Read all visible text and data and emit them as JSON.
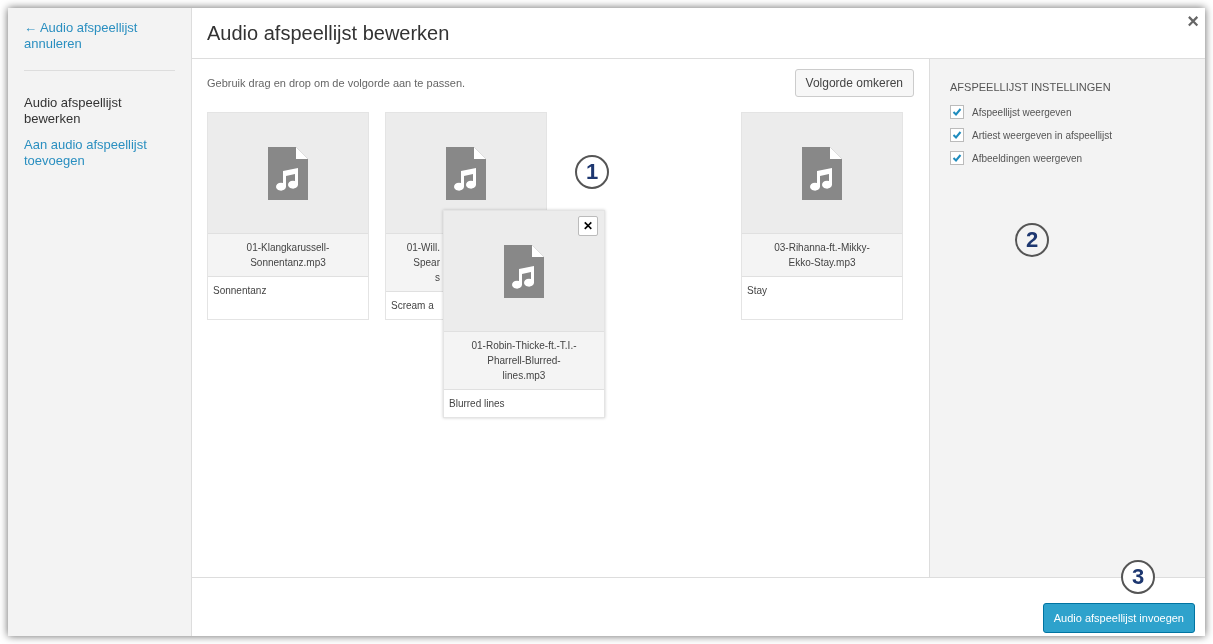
{
  "sidebar": {
    "cancel_link": "← Audio afspeellijst annuleren",
    "items": [
      {
        "label": "Audio afspeellijst bewerken",
        "selected": true
      },
      {
        "label": "Aan audio afspeellijst toevoegen",
        "selected": false
      }
    ]
  },
  "header": {
    "title": "Audio afspeellijst bewerken",
    "close": "×"
  },
  "toolbar": {
    "hint": "Gebruik drag en drop om de volgorde aan te passen.",
    "reverse_button": "Volgorde omkeren"
  },
  "tiles": [
    {
      "kind": "full",
      "filename": [
        "01-Klangkarussell-",
        "Sonnentanz.mp3"
      ],
      "title": "Sonnentanz"
    },
    {
      "kind": "covered",
      "filename": [
        "01-Will.",
        "Spear",
        "s"
      ],
      "title": "Scream a"
    },
    {
      "kind": "full",
      "filename": [
        "03-Rihanna-ft.-Mikky-",
        "Ekko-Stay.mp3"
      ],
      "title": "Stay"
    }
  ],
  "dragged_tile": {
    "filename": [
      "01-Robin-Thicke-ft.-T.I.-",
      "Pharrell-Blurred-",
      "lines.mp3"
    ],
    "title": "Blurred lines",
    "remove": "✕"
  },
  "settings": {
    "heading": "AFSPEELLIJST INSTELLINGEN",
    "options": [
      {
        "label": "Afspeellijst weergeven",
        "checked": true
      },
      {
        "label": "Artiest weergeven in afspeellijst",
        "checked": true
      },
      {
        "label": "Afbeeldingen weergeven",
        "checked": true
      }
    ]
  },
  "footer": {
    "insert_button": "Audio afspeellijst invoegen"
  },
  "callouts": [
    "1",
    "2",
    "3"
  ]
}
